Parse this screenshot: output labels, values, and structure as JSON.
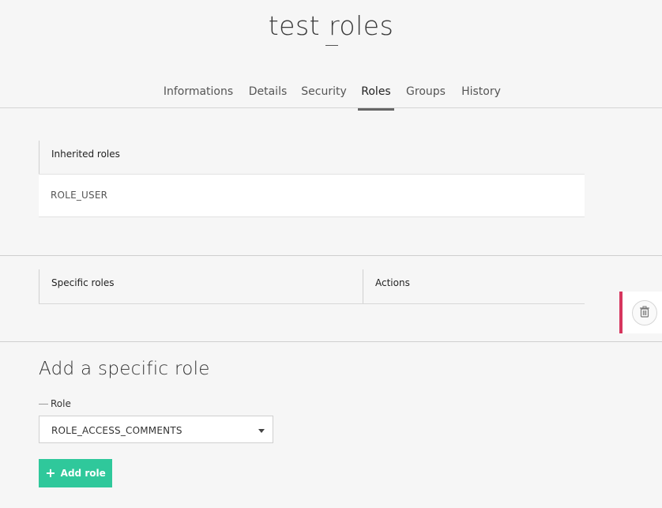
{
  "header": {
    "title": "test roles",
    "tabs": [
      {
        "label": "Informations"
      },
      {
        "label": "Details"
      },
      {
        "label": "Security"
      },
      {
        "label": "Roles",
        "active": true
      },
      {
        "label": "Groups"
      },
      {
        "label": "History"
      }
    ]
  },
  "inherited": {
    "header": "Inherited roles",
    "rows": [
      "ROLE_USER"
    ]
  },
  "specific": {
    "col_roles": "Specific roles",
    "col_actions": "Actions",
    "action_icon": "trash-icon"
  },
  "add_form": {
    "title": "Add a specific role",
    "role_label": "Role",
    "role_value": "ROLE_ACCESS_COMMENTS",
    "button_label": "Add role",
    "button_icon": "plus-icon"
  },
  "colors": {
    "accent": "#2fc89b",
    "danger_bar": "#d6365e",
    "background": "#f6f6f6"
  }
}
